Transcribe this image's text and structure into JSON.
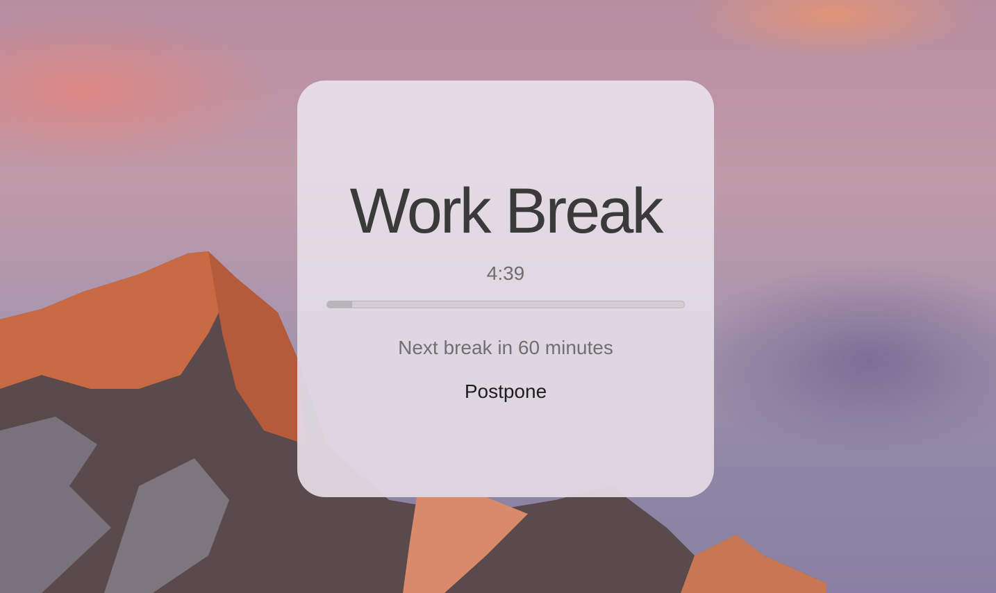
{
  "break_window": {
    "title": "Work Break",
    "timer": "4:39",
    "progress": 0.07,
    "next_break": "Next break in 60 minutes",
    "postpone_label": "Postpone"
  },
  "colors": {
    "card": "#e6dde6",
    "title": "#3a3a3a",
    "progress_fill": "#b8b5b8"
  }
}
